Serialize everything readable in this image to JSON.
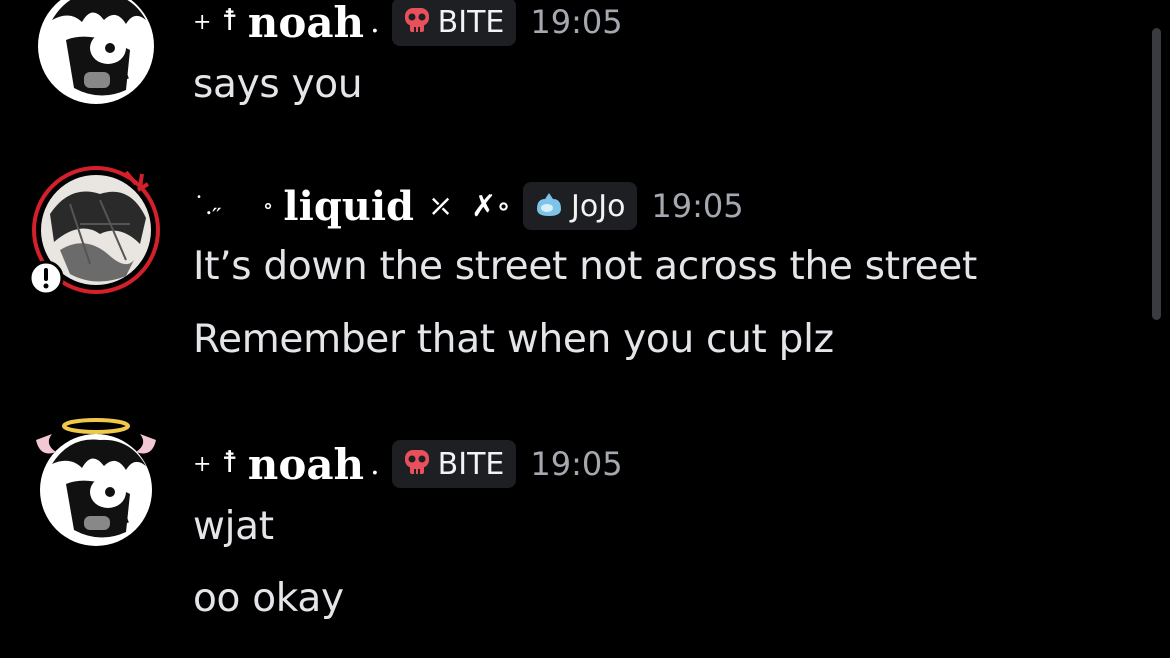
{
  "colors": {
    "background": "#000000",
    "text": "#e3e5e8",
    "timestamp": "#a5a8b0",
    "tag_background": "#1e1f22",
    "bite_icon": "#e8505b",
    "jojo_icon": "#7ec3e8",
    "status_red": "#d4202a"
  },
  "messages": [
    {
      "author": {
        "prefix": "+",
        "cross": "☨",
        "name": "noah",
        "suffix": ".",
        "avatar": "anime-boy-with-wings-avatar"
      },
      "tag": {
        "icon": "skull-icon",
        "label": "BITE"
      },
      "time": "19:05",
      "lines": [
        "says you"
      ]
    },
    {
      "author": {
        "prefix": "˙.˶",
        "dot": "∘",
        "name": "liquid",
        "flourish": "⤫",
        "glyph": "✗∘",
        "avatar": "manga-panel-avatar",
        "status": "alert-status-icon"
      },
      "tag": {
        "icon": "water-drop-icon",
        "label": "JoJo"
      },
      "time": "19:05",
      "lines": [
        "It’s down the street not across the street",
        "Remember that when you cut plz"
      ]
    },
    {
      "author": {
        "prefix": "+",
        "cross": "☨",
        "name": "noah",
        "suffix": ".",
        "avatar": "anime-boy-with-halo-avatar"
      },
      "tag": {
        "icon": "skull-icon",
        "label": "BITE"
      },
      "time": "19:05",
      "lines": [
        "wjat",
        "oo okay"
      ]
    }
  ]
}
